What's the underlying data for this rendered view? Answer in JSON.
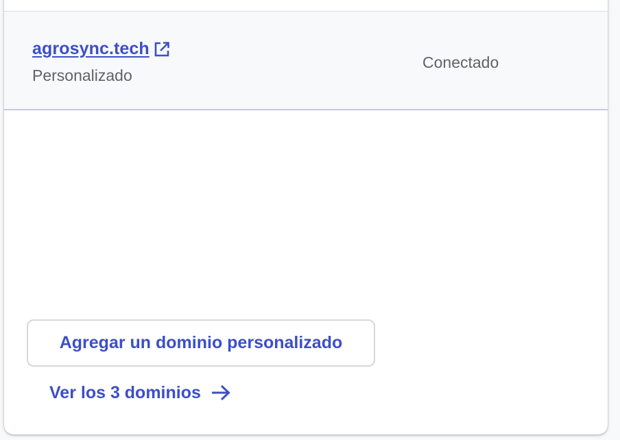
{
  "domains": {
    "rows": [
      {
        "name": "agrosync.tech",
        "type": "Personalizado",
        "status": "Conectado",
        "link_icon": "external-link-icon"
      }
    ],
    "add_button_label": "Agregar un dominio personalizado",
    "view_all_label": "Ver los 3 dominios",
    "view_all_icon": "arrow-right-icon"
  },
  "colors": {
    "accent": "#3c4fc6",
    "secondary_text": "#5f6368",
    "row_background": "#f8f9fa",
    "divider": "#c6c9e0"
  }
}
